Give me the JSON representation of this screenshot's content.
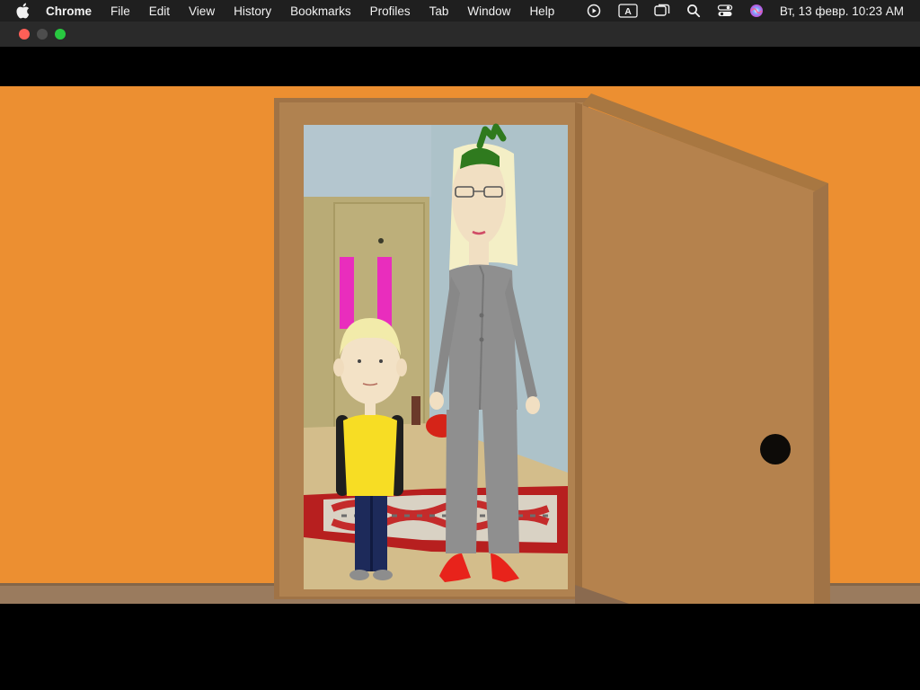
{
  "menubar": {
    "apple_icon": "apple-logo-icon",
    "app_name": "Chrome",
    "items": [
      "File",
      "Edit",
      "View",
      "History",
      "Bookmarks",
      "Profiles",
      "Tab",
      "Window",
      "Help"
    ],
    "status_icons": [
      "play-circle-icon",
      "keyboard-input-a-icon",
      "screen-mirroring-icon",
      "search-icon",
      "control-center-icon",
      "siri-icon"
    ],
    "keyboard_label": "A",
    "clock": "Вт, 13 февр.  10:23 AM"
  },
  "window": {
    "traffic_lights": {
      "close": "#fe5f57",
      "minimize": "#4d4d4d",
      "maximize": "#28c840"
    }
  },
  "video": {
    "scene": "cartoon-doorway",
    "colors": {
      "wall": "#ec8f31",
      "floor": "#9a7b5e",
      "door": "#b5824d",
      "door_frame": "#a07346",
      "boy_shirt": "#f7dd24",
      "woman_suit": "#8f8f8f",
      "shoes": "#e8231b"
    }
  }
}
